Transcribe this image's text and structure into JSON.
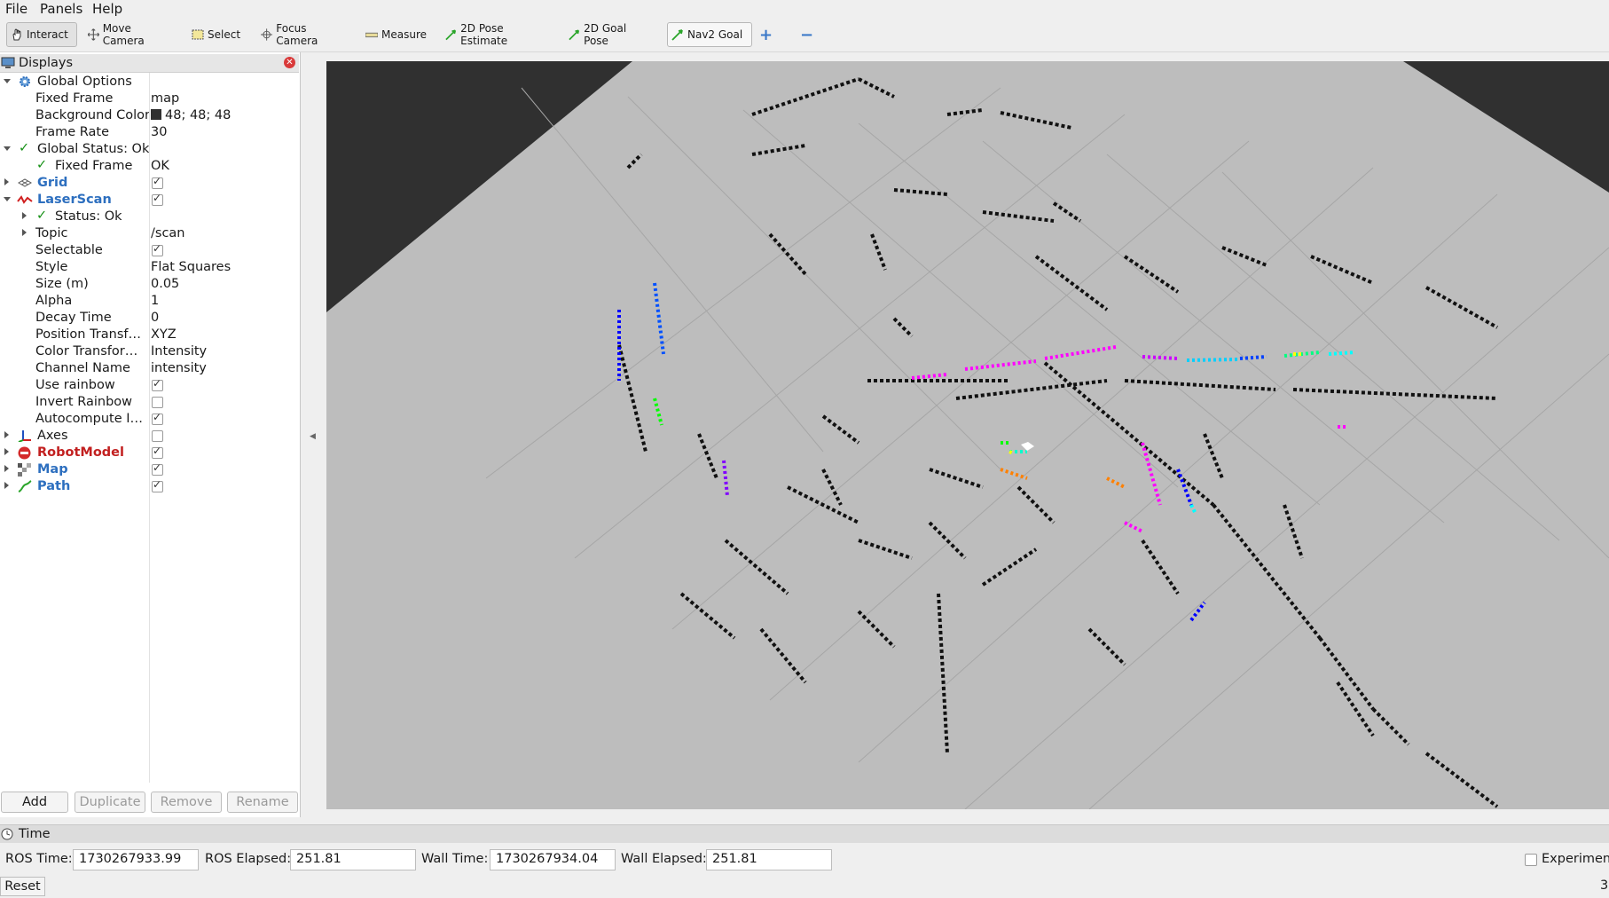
{
  "menubar": {
    "items": [
      "File",
      "Panels",
      "Help"
    ]
  },
  "toolbar": {
    "tools": [
      {
        "label": "Interact",
        "icon": "hand-icon"
      },
      {
        "label": "Move Camera",
        "icon": "move-icon"
      },
      {
        "label": "Select",
        "icon": "select-box-icon"
      },
      {
        "label": "Focus Camera",
        "icon": "crosshair-icon"
      },
      {
        "label": "Measure",
        "icon": "ruler-icon"
      },
      {
        "label": "2D Pose Estimate",
        "icon": "green-arrow-icon"
      },
      {
        "label": "2D Goal Pose",
        "icon": "green-arrow-icon"
      },
      {
        "label": "Nav2 Goal",
        "icon": "green-arrow-icon"
      }
    ],
    "add_symbol": "+",
    "remove_symbol": "−"
  },
  "displays": {
    "title": "Displays",
    "global_options": "Global Options",
    "fixed_frame_label": "Fixed Frame",
    "fixed_frame_value": "map",
    "background_color_label": "Background Color",
    "background_color_value": "48; 48; 48",
    "frame_rate_label": "Frame Rate",
    "frame_rate_value": "30",
    "global_status": "Global Status: Ok",
    "fixed_frame_status_label": "Fixed Frame",
    "fixed_frame_status_value": "OK",
    "grid": "Grid",
    "laserscan": "LaserScan",
    "status_ok": "Status: Ok",
    "topic_label": "Topic",
    "topic_value": "/scan",
    "selectable_label": "Selectable",
    "style_label": "Style",
    "style_value": "Flat Squares",
    "size_label": "Size (m)",
    "size_value": "0.05",
    "alpha_label": "Alpha",
    "alpha_value": "1",
    "decay_label": "Decay Time",
    "decay_value": "0",
    "position_transformer_label": "Position Transf…",
    "position_transformer_value": "XYZ",
    "color_transformer_label": "Color Transfor…",
    "color_transformer_value": "Intensity",
    "channel_name_label": "Channel Name",
    "channel_name_value": "intensity",
    "use_rainbow_label": "Use rainbow",
    "invert_rainbow_label": "Invert Rainbow",
    "autocompute_label": "Autocompute I…",
    "axes": "Axes",
    "robotmodel": "RobotModel",
    "map": "Map",
    "path": "Path"
  },
  "buttons": {
    "add": "Add",
    "duplicate": "Duplicate",
    "remove": "Remove",
    "rename": "Rename"
  },
  "time": {
    "title": "Time",
    "ros_time_label": "ROS Time:",
    "ros_time_value": "1730267933.99",
    "ros_elapsed_label": "ROS Elapsed:",
    "ros_elapsed_value": "251.81",
    "wall_time_label": "Wall Time:",
    "wall_time_value": "1730267934.04",
    "wall_elapsed_label": "Wall Elapsed:",
    "wall_elapsed_value": "251.81",
    "experimental_label": "Experimental",
    "reset": "Reset",
    "fps_partial": "3"
  },
  "colors": {
    "viewport_background": "#303030",
    "map_floor": "#bdbdbd",
    "obstacle": "#111111",
    "accent_blue": "#2d6fbf",
    "accent_red": "#c22020"
  }
}
